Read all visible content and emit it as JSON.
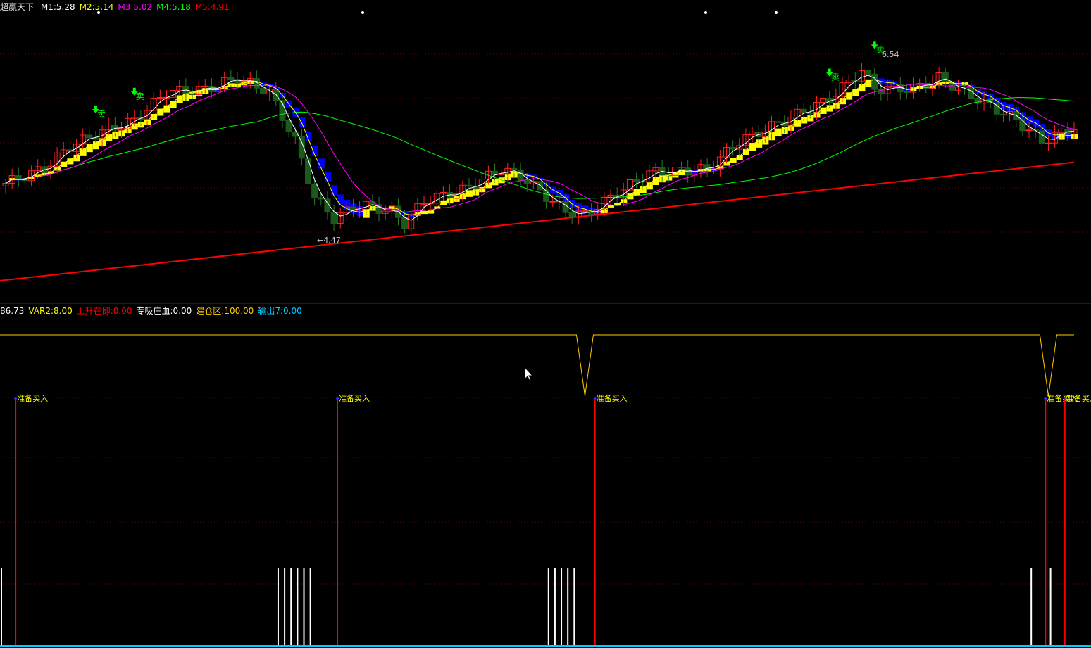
{
  "title": "超赢天下",
  "top_legend": [
    {
      "label": "M1:5.28",
      "color": "#ffffff"
    },
    {
      "label": "M2:5.14",
      "color": "#ffff00"
    },
    {
      "label": "M3:5.02",
      "color": "#ff00ff"
    },
    {
      "label": "M4:5.18",
      "color": "#00ff00"
    },
    {
      "label": "M5:4.91",
      "color": "#ff0000"
    }
  ],
  "mid_legend": [
    {
      "label": "86.73",
      "color": "#ffffff"
    },
    {
      "label": "VAR2:8.00",
      "color": "#ffff00"
    },
    {
      "label": "上升在即:0.00",
      "color": "#ff0000"
    },
    {
      "label": "专吸庄血:0.00",
      "color": "#ffffff"
    },
    {
      "label": "建仓区:100.00",
      "color": "#ffcc00"
    },
    {
      "label": "输出7:0.00",
      "color": "#00ccff"
    }
  ],
  "chart_data": [
    {
      "type": "candlestick",
      "title": "超赢天下",
      "price_range": [
        3.67,
        7.12
      ],
      "close_path": [
        [
          0,
          5.03
        ],
        [
          6,
          5.2
        ],
        [
          10,
          5.45
        ],
        [
          14,
          5.59
        ],
        [
          20,
          5.75
        ],
        [
          25,
          6.07
        ],
        [
          31,
          6.1
        ],
        [
          36,
          6.23
        ],
        [
          41,
          6.07
        ],
        [
          45,
          5.51
        ],
        [
          48,
          4.87
        ],
        [
          51,
          4.63
        ],
        [
          55,
          4.79
        ],
        [
          60,
          4.71
        ],
        [
          62,
          4.57
        ],
        [
          65,
          4.83
        ],
        [
          71,
          4.95
        ],
        [
          77,
          5.19
        ],
        [
          80,
          5.11
        ],
        [
          87,
          4.71
        ],
        [
          90,
          4.67
        ],
        [
          94,
          4.87
        ],
        [
          100,
          5.15
        ],
        [
          109,
          5.19
        ],
        [
          114,
          5.51
        ],
        [
          120,
          5.71
        ],
        [
          128,
          5.99
        ],
        [
          133,
          6.32
        ],
        [
          135,
          6.11
        ],
        [
          141,
          6.11
        ],
        [
          145,
          6.23
        ],
        [
          150,
          6.03
        ],
        [
          157,
          5.75
        ],
        [
          161,
          5.51
        ],
        [
          166,
          5.67
        ]
      ],
      "candle_count": 167,
      "trend_line": [
        3.92,
        5.27
      ],
      "high_label": "6.54",
      "low_label": "←4.47",
      "sell_label": "卖",
      "sell_at": [
        14,
        20,
        128,
        135
      ]
    },
    {
      "type": "signal",
      "buy_label": "准备买入",
      "buy_at": [
        1,
        51,
        91,
        161,
        164
      ],
      "dips_at": [
        90,
        162
      ],
      "white_bars_at": [
        0,
        43,
        44,
        45,
        46,
        47,
        48,
        85,
        86,
        87,
        88,
        89,
        160,
        163
      ]
    }
  ],
  "colors": {
    "up": "#ff2020",
    "down": "#1a5a1a",
    "grid": "#6a0000",
    "m1": "#ffffff",
    "m2": "#ffff00",
    "m3": "#ff00ff",
    "m4": "#00ff00",
    "m5": "#ff0000",
    "band_up": "#ffff00",
    "band_down": "#0000ff",
    "signal": "#ffcc00",
    "cyan": "#00ccff"
  }
}
